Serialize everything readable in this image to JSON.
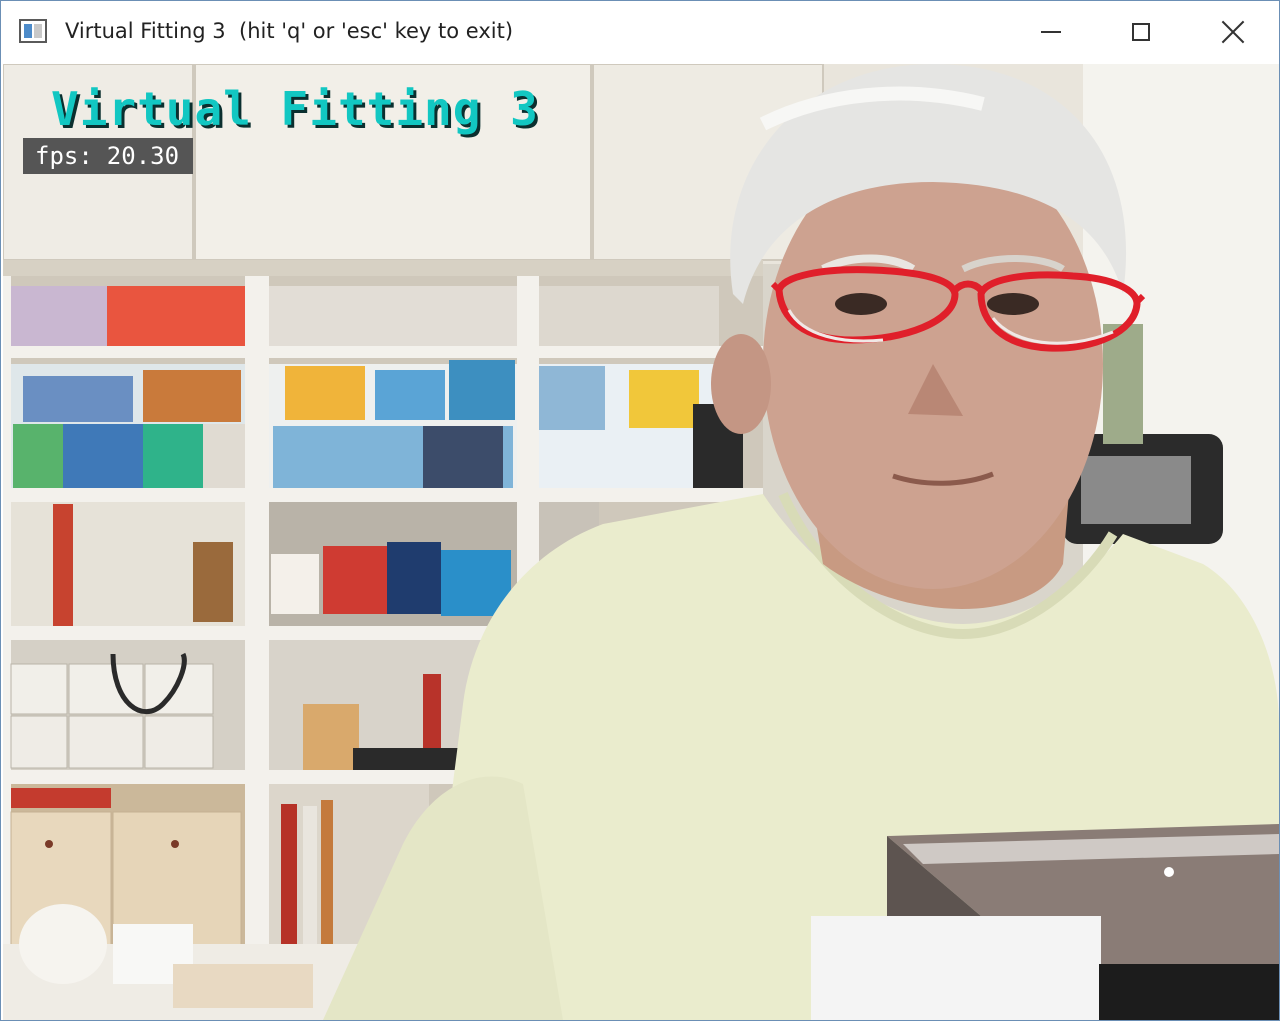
{
  "window": {
    "title": "Virtual Fitting 3  (hit 'q' or 'esc' key to exit)",
    "icon": "opencv-window-icon",
    "controls": {
      "minimize": "minimize-icon",
      "maximize": "maximize-icon",
      "close": "close-icon"
    }
  },
  "overlay": {
    "title": "Virtual Fitting 3",
    "fps_label": "fps:",
    "fps_value": "20.30",
    "title_color": "#12c7c2",
    "fps_box_color": "#555555"
  },
  "glasses": {
    "frame_color": "#e01f2a"
  }
}
